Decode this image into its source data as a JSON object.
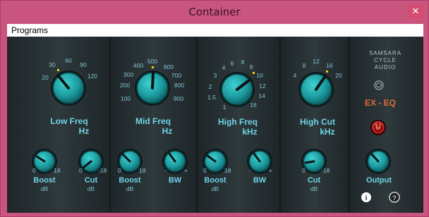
{
  "window": {
    "title": "Container",
    "close_glyph": "✕"
  },
  "menu": {
    "programs": "Programs"
  },
  "brand": {
    "line1": "SAMSARA",
    "line2": "CYCLE",
    "line3": "AUDIO",
    "product": "EX - EQ",
    "logo_icon": "swirl-icon"
  },
  "bands": {
    "low_freq": {
      "name": "Low Freq",
      "unit": "Hz",
      "ticks": [
        "20",
        "30",
        "60",
        "90",
        "120"
      ]
    },
    "mid_freq": {
      "name": "Mid Freq",
      "unit": "Hz",
      "ticks": [
        "100",
        "200",
        "300",
        "400",
        "500",
        "600",
        "700",
        "800",
        "900"
      ]
    },
    "high_freq": {
      "name": "High Freq",
      "unit": "kHz",
      "ticks": [
        "1",
        "1.5",
        "2",
        "3",
        "4",
        "6",
        "8",
        "9",
        "10",
        "12",
        "14",
        "16"
      ]
    },
    "high_cut": {
      "name": "High Cut",
      "unit": "kHz",
      "ticks": [
        "4",
        "8",
        "12",
        "16",
        "20"
      ]
    }
  },
  "small": {
    "low_boost": {
      "name": "Boost",
      "unit": "dB",
      "min": "0",
      "max": "18"
    },
    "low_cut": {
      "name": "Cut",
      "unit": "dB",
      "min": "0",
      "max": "-18"
    },
    "mid_boost": {
      "name": "Boost",
      "unit": "dB",
      "min": "0",
      "max": "18"
    },
    "mid_bw": {
      "name": "BW",
      "min": "-",
      "max": "+"
    },
    "high_boost": {
      "name": "Boost",
      "unit": "dB",
      "min": "0",
      "max": "18"
    },
    "high_bw": {
      "name": "BW",
      "min": "-",
      "max": "+"
    },
    "cut": {
      "name": "Cut",
      "unit": "dB",
      "min": "0",
      "max": "-18"
    },
    "output": {
      "name": "Output"
    }
  },
  "icons": {
    "info": "i",
    "help": "?"
  },
  "colors": {
    "knob": "#1b9a9e",
    "label": "#6fd4e6",
    "accent": "#f0d000",
    "power": "#d82020",
    "product": "#e06a3a"
  }
}
